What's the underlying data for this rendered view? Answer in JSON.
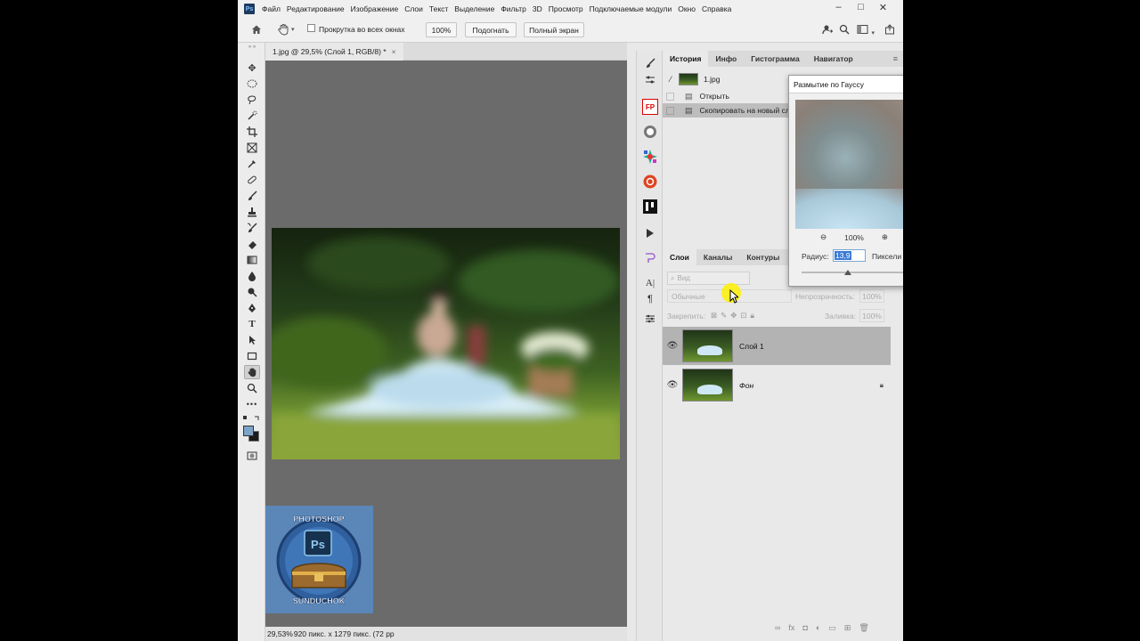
{
  "app": {
    "logo_text": "Ps"
  },
  "menu": [
    "Файл",
    "Редактирование",
    "Изображение",
    "Слои",
    "Текст",
    "Выделение",
    "Фильтр",
    "3D",
    "Просмотр",
    "Подключаемые модули",
    "Окно",
    "Справка"
  ],
  "window_controls": {
    "minimize": "–",
    "restore": "□",
    "close": "✕"
  },
  "options_bar": {
    "scroll_all_label": "Прокрутка во всех окнах",
    "zoom_100_label": "100%",
    "fit_label": "Подогнать",
    "fullscreen_label": "Полный экран"
  },
  "document": {
    "tab_title": "1.jpg @ 29,5% (Слой 1, RGB/8) *",
    "tab_close": "×"
  },
  "status": {
    "zoom": "29,53%",
    "info": "920 пикс. x 1279 пикс. (72 pp"
  },
  "watermark": {
    "top_text": "PHOTOSHOP",
    "bottom_text": "SUNDUCHOK",
    "badge": "Ps"
  },
  "side_icons": {
    "fp_label": "FP"
  },
  "history_panel": {
    "tabs": [
      "История",
      "Инфо",
      "Гистограмма",
      "Навигатор"
    ],
    "active_tab": "История",
    "snapshot": "1.jpg",
    "items": [
      "Открыть",
      "Скопировать на новый сл"
    ]
  },
  "layers_panel": {
    "tabs": [
      "Слои",
      "Каналы",
      "Контуры"
    ],
    "active_tab": "Слои",
    "filter_placeholder": "Вид",
    "blend_mode": "Обычные",
    "opacity_label": "Непрозрачность:",
    "opacity_value": "100%",
    "lock_label": "Закрепить:",
    "fill_label": "Заливка:",
    "fill_value": "100%",
    "layers": [
      {
        "name": "Слой 1",
        "selected": true,
        "locked": false
      },
      {
        "name": "Фон",
        "selected": false,
        "locked": true
      }
    ]
  },
  "gaussian_dialog": {
    "title": "Размытие по Гауссу",
    "zoom_value": "100%",
    "radius_label": "Радиус:",
    "radius_value": "13,9",
    "units_label": "Пиксели"
  }
}
